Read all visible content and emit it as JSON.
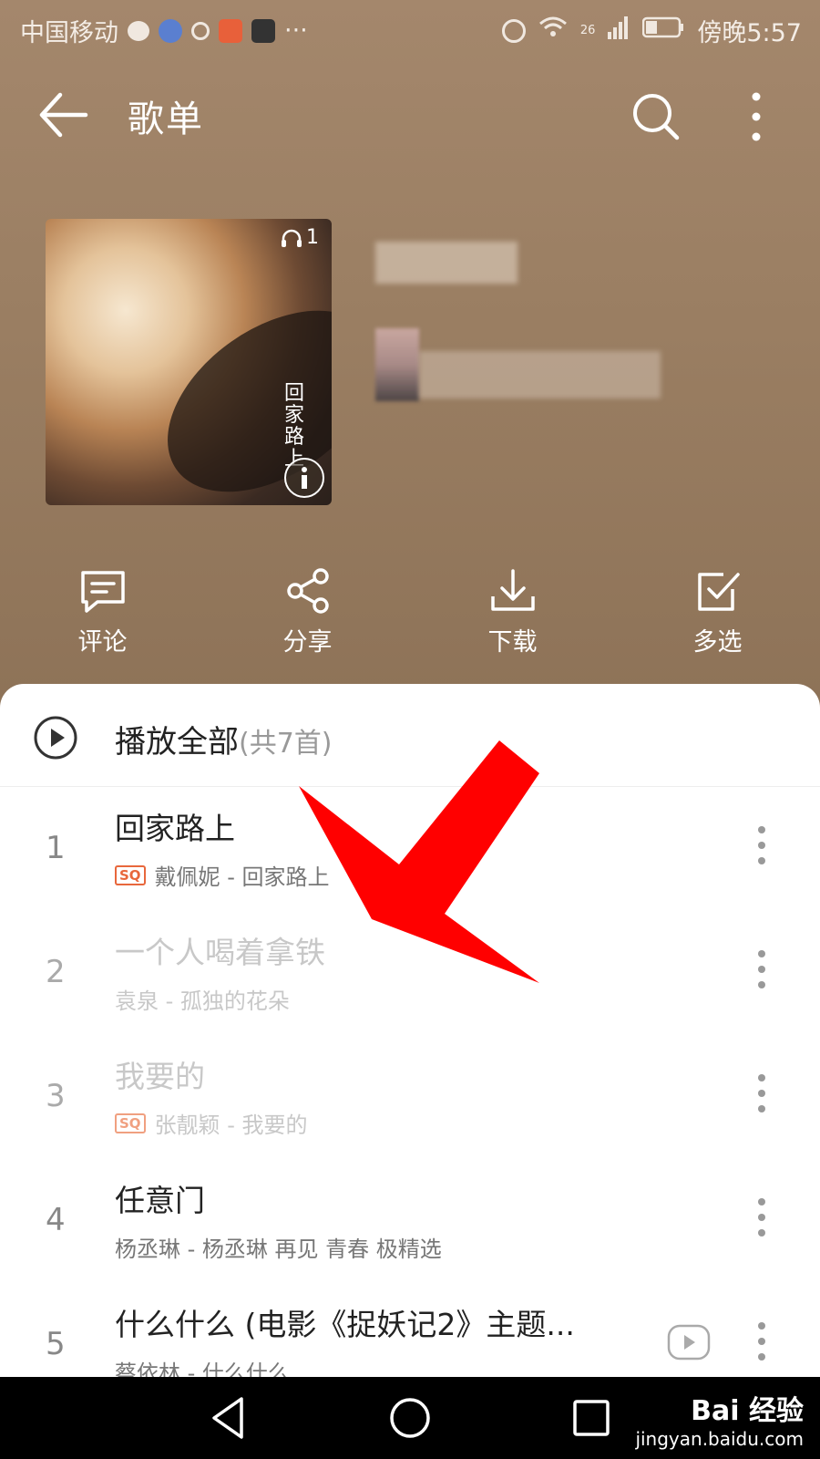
{
  "status_bar": {
    "carrier": "中国移动",
    "more": "···",
    "network": "26",
    "time": "傍晚5:57"
  },
  "app_bar": {
    "title": "歌单"
  },
  "cover": {
    "listen_count": "1",
    "vertical_text": "回家路上"
  },
  "actions": [
    {
      "label": "评论",
      "icon": "comment-icon"
    },
    {
      "label": "分享",
      "icon": "share-icon"
    },
    {
      "label": "下载",
      "icon": "download-icon"
    },
    {
      "label": "多选",
      "icon": "multi-select-icon"
    }
  ],
  "play_all": {
    "label": "播放全部",
    "count": "(共7首)"
  },
  "songs": [
    {
      "index": "1",
      "title": "回家路上",
      "subtitle": "戴佩妮 - 回家路上",
      "sq": "SQ",
      "dimmed": false
    },
    {
      "index": "2",
      "title": "一个人喝着拿铁",
      "subtitle": "袁泉 - 孤独的花朵",
      "sq": "",
      "dimmed": true
    },
    {
      "index": "3",
      "title": "我要的",
      "subtitle": "张靓颖 - 我要的",
      "sq": "SQ",
      "dimmed": true
    },
    {
      "index": "4",
      "title": "任意门",
      "subtitle": "杨丞琳 - 杨丞琳 再见 青春 极精选",
      "sq": "",
      "dimmed": false
    },
    {
      "index": "5",
      "title": "什么什么 (电影《捉妖记2》主题...",
      "subtitle": "蔡依林 - 什么什么",
      "sq": "",
      "dimmed": false
    }
  ],
  "watermark": {
    "brand": "Bai 经验",
    "url": "jingyan.baidu.com"
  },
  "colors": {
    "header_bg": "#9b7f63",
    "accent_sq": "#e8673c",
    "arrow": "#ff0000"
  }
}
